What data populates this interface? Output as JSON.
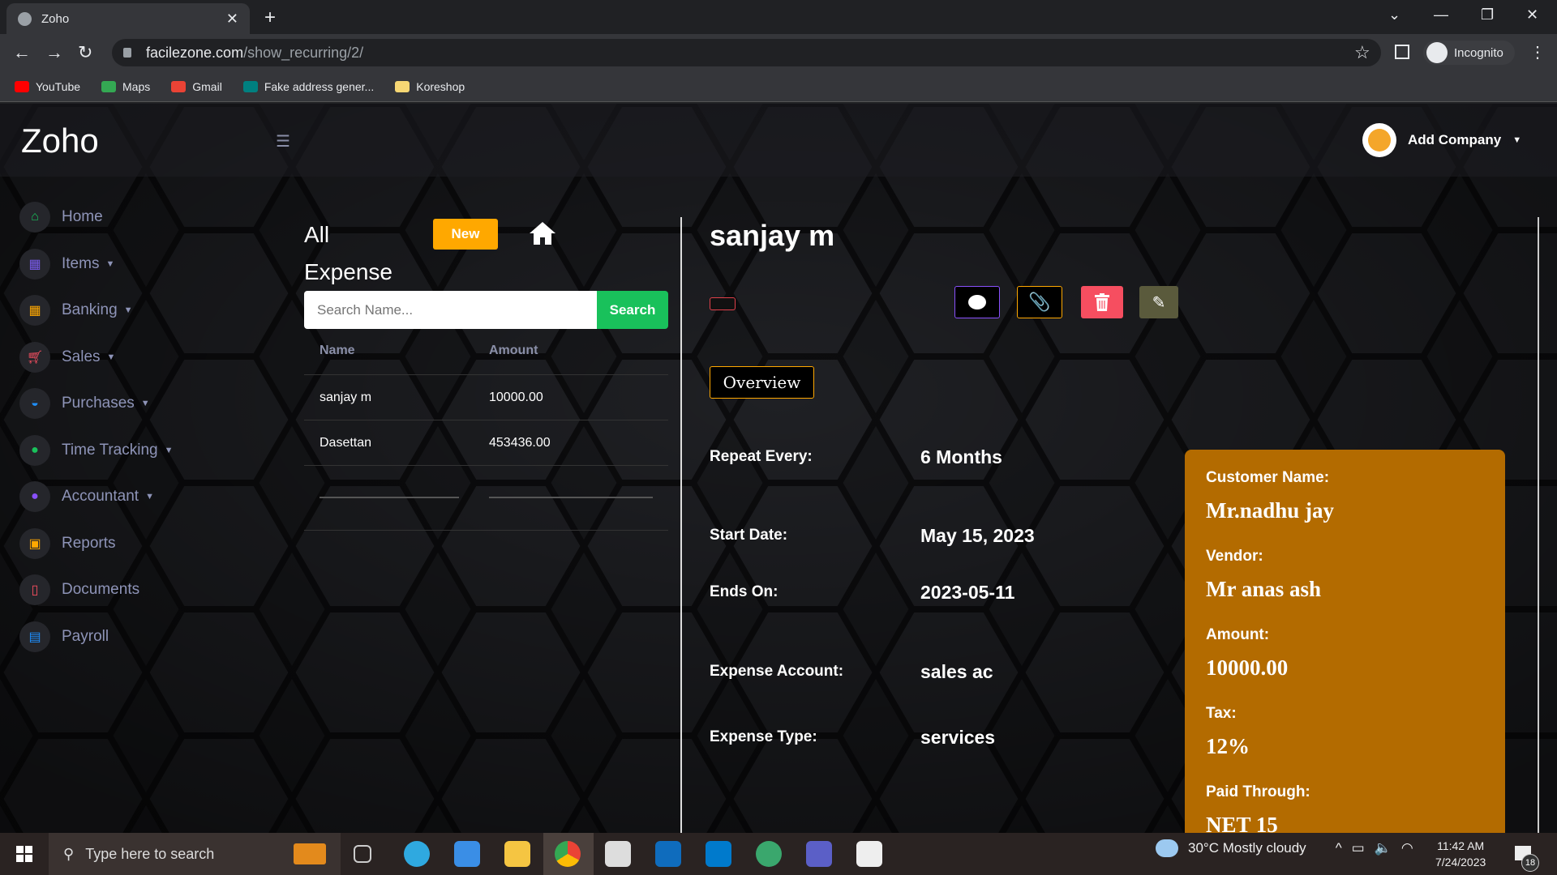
{
  "browser": {
    "tab_title": "Zoho",
    "url_host": "facilezone.com",
    "url_path": "/show_recurring/2/",
    "profile": "Incognito",
    "bookmarks": [
      {
        "label": "YouTube",
        "color": "#ff0000"
      },
      {
        "label": "Maps",
        "color": "#34a853"
      },
      {
        "label": "Gmail",
        "color": "#ea4335"
      },
      {
        "label": "Fake address gener...",
        "color": "#008080"
      },
      {
        "label": "Koreshop",
        "color": "#f7d774"
      }
    ]
  },
  "app": {
    "logo": "Zoho",
    "account": "Add Company"
  },
  "sidebar": {
    "items": [
      {
        "label": "Home",
        "color": "#19c15b",
        "icon": "home-icon"
      },
      {
        "label": "Items",
        "color": "#7b5cf0",
        "icon": "sitemap-icon",
        "caret": true
      },
      {
        "label": "Banking",
        "color": "#ffa800",
        "icon": "sitemap-icon",
        "caret": true
      },
      {
        "label": "Sales",
        "color": "#f64e60",
        "icon": "cart-icon",
        "caret": true
      },
      {
        "label": "Purchases",
        "color": "#1e90ff",
        "icon": "basket-icon",
        "caret": true
      },
      {
        "label": "Time Tracking",
        "color": "#19c15b",
        "icon": "clock-icon",
        "caret": true
      },
      {
        "label": "Accountant",
        "color": "#8950fc",
        "icon": "user-icon",
        "caret": true
      },
      {
        "label": "Reports",
        "color": "#ffa800",
        "icon": "calendar-icon"
      },
      {
        "label": "Documents",
        "color": "#f64e60",
        "icon": "file-icon"
      },
      {
        "label": "Payroll",
        "color": "#1e90ff",
        "icon": "money-icon"
      }
    ]
  },
  "list": {
    "heading_line1": "All",
    "heading_line2": "Expense",
    "new_label": "New",
    "search_placeholder": "Search Name...",
    "search_label": "Search",
    "columns": [
      "Name",
      "Amount"
    ],
    "rows": [
      {
        "name": "sanjay m",
        "amount": "10000.00"
      },
      {
        "name": "Dasettan",
        "amount": "453436.00"
      }
    ]
  },
  "detail": {
    "title": "sanjay m",
    "overview_label": "Overview",
    "fields": [
      {
        "label": "Repeat Every:",
        "value": "6 Months"
      },
      {
        "label": "Start Date:",
        "value": "May 15, 2023"
      },
      {
        "label": "Ends On:",
        "value": "2023-05-11"
      },
      {
        "label": "Expense Account:",
        "value": "sales ac"
      },
      {
        "label": "Expense Type:",
        "value": "services"
      }
    ],
    "card": [
      {
        "label": "Customer Name:",
        "value": "Mr.nadhu jay"
      },
      {
        "label": "Vendor:",
        "value": "Mr anas ash"
      },
      {
        "label": "Amount:",
        "value": "10000.00"
      },
      {
        "label": "Tax:",
        "value": "12%"
      },
      {
        "label": "Paid Through:",
        "value": "NET 15"
      }
    ]
  },
  "taskbar": {
    "search_placeholder": "Type here to search",
    "weather": "30°C  Mostly cloudy",
    "time": "11:42 AM",
    "date": "7/24/2023",
    "notifications": "18"
  }
}
